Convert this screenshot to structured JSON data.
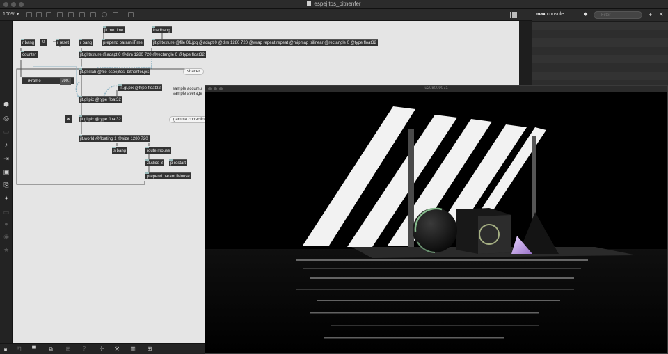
{
  "window": {
    "title": "espejitos_bitnenfer"
  },
  "toolbar": {
    "zoom": "100%",
    "zoom_caret": "▾"
  },
  "patcher": {
    "objects": {
      "jit_mo_time": "jit.mo.time",
      "loadbang": "loadbang",
      "r_bang_1": "r bang",
      "num_0": "0",
      "r_reset": "r reset",
      "r_bang_2": "r bang",
      "prepend_itime": "prepend param iTime",
      "jit_gl_texture_file": "jit.gl.texture @file 01.jpg @adapt 0 @dim 1280 720 @wrap repeat repeat @mipmap trilinear @rectangle 0 @type float32",
      "counter": "counter",
      "jit_gl_texture_adapt": "jit.gl.texture @adapt 0 @dim 1280 720 @rectangle 0 @type float32",
      "jit_gl_slab": "jit.gl.slab @file espejitos_bitnenfer.jxs",
      "iframe_label": "iFrame",
      "iframe_value": "790.",
      "jit_gl_pix_1": "jit.gl.pix @type float32",
      "jit_gl_pix_2": "jit.gl.pix @type float32",
      "jit_gl_pix_3": "jit.gl.pix @type float32",
      "jit_world": "jit.world @floating 1 @size 1280 720",
      "s_bang": "s bang",
      "route_mouse": "route mouse",
      "zl_slice": "zl.slice 3",
      "p_restart": "p restart",
      "prepend_imouse": "prepend param iMouse"
    },
    "comments": {
      "shader": "shader",
      "sample_accum": "sample accumu",
      "sample_avg": "sample average",
      "gamma": "gamma correctio"
    },
    "toggle_glyph": "✕"
  },
  "console": {
    "title_bold": "max",
    "title_rest": " console",
    "filter_placeholder": "Filter",
    "filter_icon": "🔍",
    "add": "+",
    "close": "✕",
    "diamond": "◆"
  },
  "jit_window": {
    "title": "u208009071"
  },
  "icons": {
    "left_sidebar": [
      "cube-icon",
      "circle-target-icon",
      "comment-icon",
      "music-note-icon",
      "step-icon",
      "image-icon",
      "link-icon",
      "gear-icon",
      "device-icon",
      "object-icon",
      "package-icon",
      "star-icon"
    ],
    "bottom_bar": [
      "lock-icon",
      "presentation-icon",
      "windows-icon",
      "gamepad-icon",
      "help-icon",
      "wrench-icon",
      "piano-icon",
      "grid-icon"
    ]
  }
}
